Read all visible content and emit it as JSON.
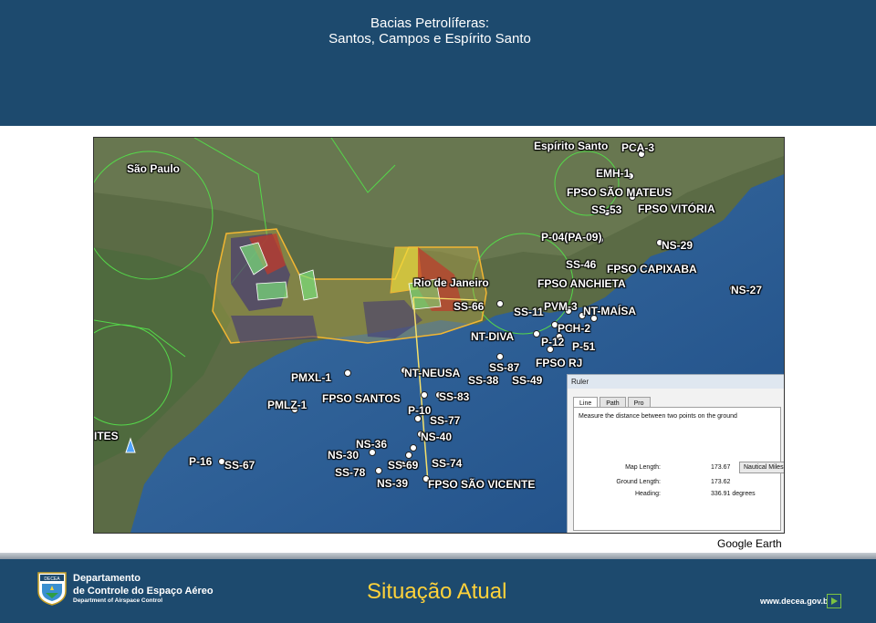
{
  "header": {
    "title_line1": "Bacias Petrolíferas:",
    "title_line2": "Santos, Campos e Espírito Santo"
  },
  "map": {
    "place_labels": {
      "sao_paulo": "São Paulo",
      "rio_de_janeiro": "Rio de Janeiro",
      "espirito_santo": "Espírito Santo",
      "ites": "ITES"
    },
    "points": {
      "pca3": "PCA-3",
      "emh1": "EMH-1",
      "fpso_sao_mateus": "FPSO SÃO MATEUS",
      "ss53": "SS-53",
      "fpso_vitoria": "FPSO VITÓRIA",
      "p04": "P-04(PA-09)",
      "ns29": "NS-29",
      "ss46": "SS-46",
      "fpso_capixaba": "FPSO CAPIXABA",
      "fpso_anchieta": "FPSO ANCHIETA",
      "ns27": "NS-27",
      "ss66": "SS-66",
      "pvm3": "PVM-3",
      "ss11": "SS-11",
      "nt_maisa": "NT-MAÍSA",
      "pch2": "PCH-2",
      "nt_diva": "NT-DIVA",
      "p12": "P-12",
      "p51": "P-51",
      "ss87": "SS-87",
      "fpso_rj": "FPSO RJ",
      "pmxl1": "PMXL-1",
      "nt_neusa": "NT-NEUSA",
      "ss38": "SS-38",
      "ss49": "SS-49",
      "fpso_santos": "FPSO SANTOS",
      "ss83": "SS-83",
      "pmlz1": "PMLZ-1",
      "p10": "P-10",
      "ss77": "SS-77",
      "ns40": "NS-40",
      "ns36": "NS-36",
      "ns30": "NS-30",
      "p16": "P-16",
      "ss67": "SS-67",
      "ss69": "SS-69",
      "ss74": "SS-74",
      "ss78": "SS-78",
      "ns39": "NS-39",
      "fpso_sao_vicente": "FPSO SÃO VICENTE"
    }
  },
  "ruler": {
    "title": "Ruler",
    "tabs": [
      "Line",
      "Path",
      "Pro"
    ],
    "active_tab": "Line",
    "description": "Measure the distance between two points on the ground",
    "map_length_label": "Map Length:",
    "map_length_value": "173.67",
    "unit": "Nautical Miles",
    "ground_length_label": "Ground Length:",
    "ground_length_value": "173.62",
    "heading_label": "Heading:",
    "heading_value": "336.91 degrees"
  },
  "caption": "Google Earth",
  "footer": {
    "org_line1": "Departamento",
    "org_line2": "de Controle do Espaço Aéreo",
    "org_line3": "Department of Airspace Control",
    "logo_text": "DECEA",
    "subtitle": "Situação Atual",
    "website": "www.decea.gov.br"
  },
  "colors": {
    "header_bg": "#1d4a6e",
    "subtitle": "#ffd23a",
    "airspace_outline": "#f2b632",
    "ruler_line": "#f5e16a"
  }
}
